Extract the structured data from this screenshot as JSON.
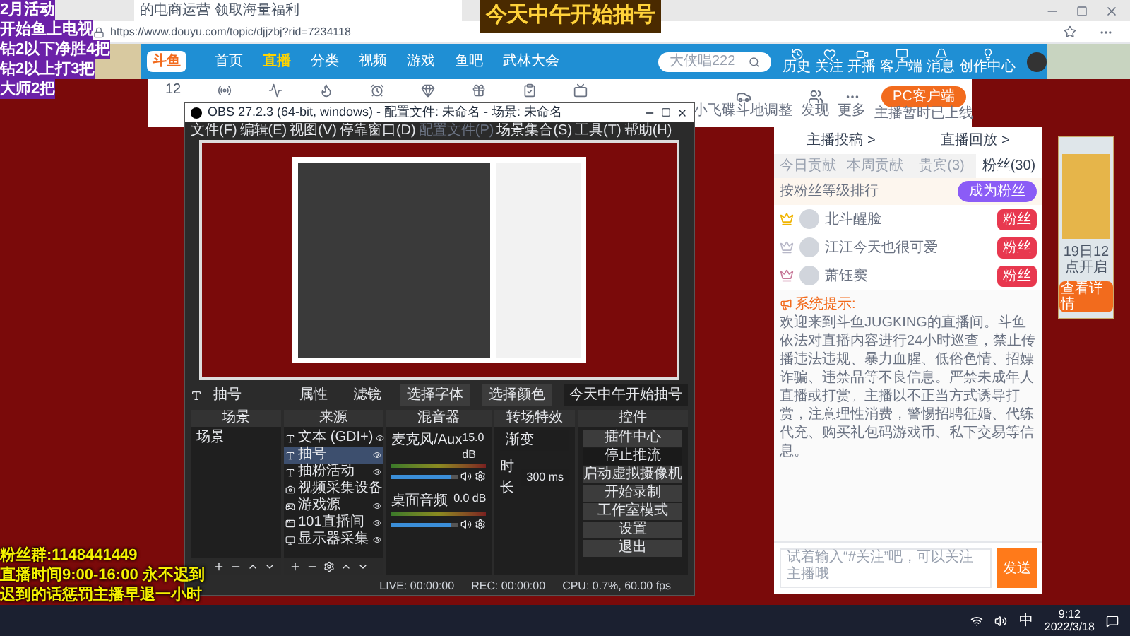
{
  "browser": {
    "tab_title": "的电商运营 领取海量福利",
    "url": "https://www.douyu.com/topic/djjzbj?rid=7234118"
  },
  "nav": {
    "logo": "斗鱼",
    "items": [
      {
        "label": "首页",
        "selected": false
      },
      {
        "label": "直播",
        "selected": true
      },
      {
        "label": "分类",
        "selected": false
      },
      {
        "label": "视频",
        "selected": false
      },
      {
        "label": "游戏",
        "selected": false
      },
      {
        "label": "鱼吧",
        "selected": false
      },
      {
        "label": "武林大会",
        "selected": false
      }
    ],
    "search_placeholder": "大侠唱222",
    "icons": [
      "历史",
      "关注",
      "开播",
      "客户端",
      "消息",
      "创作中心"
    ]
  },
  "category_row": {
    "count": "12",
    "labels": [
      "小飞碟斗地调整",
      "发现",
      "更多"
    ],
    "pc_button": "PC客户端",
    "pc_note": "主播暂时已上线"
  },
  "obs": {
    "title": "OBS 27.2.3 (64-bit, windows) - 配置文件: 未命名 - 场景: 未命名",
    "menu": [
      {
        "label": "文件(F)",
        "disabled": false
      },
      {
        "label": "编辑(E)",
        "disabled": false
      },
      {
        "label": "视图(V)",
        "disabled": false
      },
      {
        "label": "停靠窗口(D)",
        "disabled": false
      },
      {
        "label": "配置文件(P)",
        "disabled": true
      },
      {
        "label": "场景集合(S)",
        "disabled": false
      },
      {
        "label": "工具(T)",
        "disabled": false
      },
      {
        "label": "帮助(H)",
        "disabled": false
      }
    ],
    "source_toolbar": {
      "source": "抽号",
      "buttons": [
        "属性",
        "滤镜",
        "选择字体",
        "选择颜色"
      ],
      "text_value": "今天中午开始抽号"
    },
    "docks": {
      "scenes": "场景",
      "sources": "来源",
      "mixer": "混音器",
      "transitions": "转场特效",
      "controls": "控件"
    },
    "scenes": [
      {
        "label": "场景",
        "selected": false
      }
    ],
    "sources": [
      {
        "label": "文本 (GDI+)",
        "kind": "text",
        "selected": false
      },
      {
        "label": "抽号",
        "kind": "text",
        "selected": true
      },
      {
        "label": "抽粉活动",
        "kind": "text",
        "selected": false
      },
      {
        "label": "视频采集设备",
        "kind": "camera",
        "selected": false
      },
      {
        "label": "游戏源",
        "kind": "game",
        "selected": false
      },
      {
        "label": "101直播间",
        "kind": "window",
        "selected": false
      },
      {
        "label": "显示器采集",
        "kind": "display",
        "selected": false
      }
    ],
    "mixer": [
      {
        "name": "麦克风/Aux",
        "reading": "15.0 dB",
        "level": 0.88
      },
      {
        "name": "桌面音频",
        "reading": "0.0 dB",
        "level": 0.88
      }
    ],
    "transition": {
      "value": "渐变",
      "duration_label": "时长",
      "duration": "300 ms"
    },
    "controls": [
      {
        "label": "插件中心",
        "active": false
      },
      {
        "label": "停止推流",
        "active": true
      },
      {
        "label": "启动虚拟摄像机",
        "active": false
      },
      {
        "label": "开始录制",
        "active": false
      },
      {
        "label": "工作室模式",
        "active": false
      },
      {
        "label": "设置",
        "active": false
      },
      {
        "label": "退出",
        "active": false
      }
    ],
    "status": {
      "live": "LIVE: 00:00:00",
      "rec": "REC: 00:00:00",
      "cpu": "CPU: 0.7%, 60.00 fps"
    }
  },
  "chat": {
    "links": [
      "主播投稿 >",
      "直播回放 >"
    ],
    "tabs": [
      {
        "label": "今日贡献",
        "selected": false
      },
      {
        "label": "本周贡献",
        "selected": false
      },
      {
        "label": "贵宾(3)",
        "selected": false
      },
      {
        "label": "粉丝(30)",
        "selected": true
      }
    ],
    "rank_title": "按粉丝等级排行",
    "join_button": "成为粉丝",
    "fans": [
      {
        "name": "北斗醒脸",
        "color": "#f0b400",
        "badge": "粉丝"
      },
      {
        "name": "江江今天也很可爱",
        "color": "#b8b8c8",
        "badge": "粉丝"
      },
      {
        "name": "萧钰窦",
        "color": "#c87a9a",
        "badge": "粉丝"
      }
    ],
    "notice_label": "系统提示:",
    "notice": "欢迎来到斗鱼JUGKING的直播间。斗鱼依法对直播内容进行24小时巡查，禁止传播违法违规、暴力血腥、低俗色情、招嫖诈骗、违禁品等不良信息。严禁未成年人直播或打赏。主播以不正当方式诱导打赏，注意理性消费，警惕招聘征婚、代练代充、购买礼包码游戏币、私下交易等信息。",
    "input_placeholder": "试着输入“#关注”吧，可以关注主播哦",
    "send": "发送"
  },
  "ad": {
    "date": "19日12点开启",
    "button": "查看详情"
  },
  "overlay": {
    "left": [
      "2月活动",
      "开始鱼上电视",
      "钻2以下净胜4把",
      "钻2以上打3把",
      "大师2把"
    ],
    "top": "今天中午开始抽号",
    "bottom": [
      "粉丝群:1148441449",
      "直播时间9:00-16:00 永不迟到",
      "迟到的话惩罚主播早退一小时"
    ]
  },
  "taskbar": {
    "ime": "中",
    "time": "9:12",
    "date": "2022/3/18"
  }
}
